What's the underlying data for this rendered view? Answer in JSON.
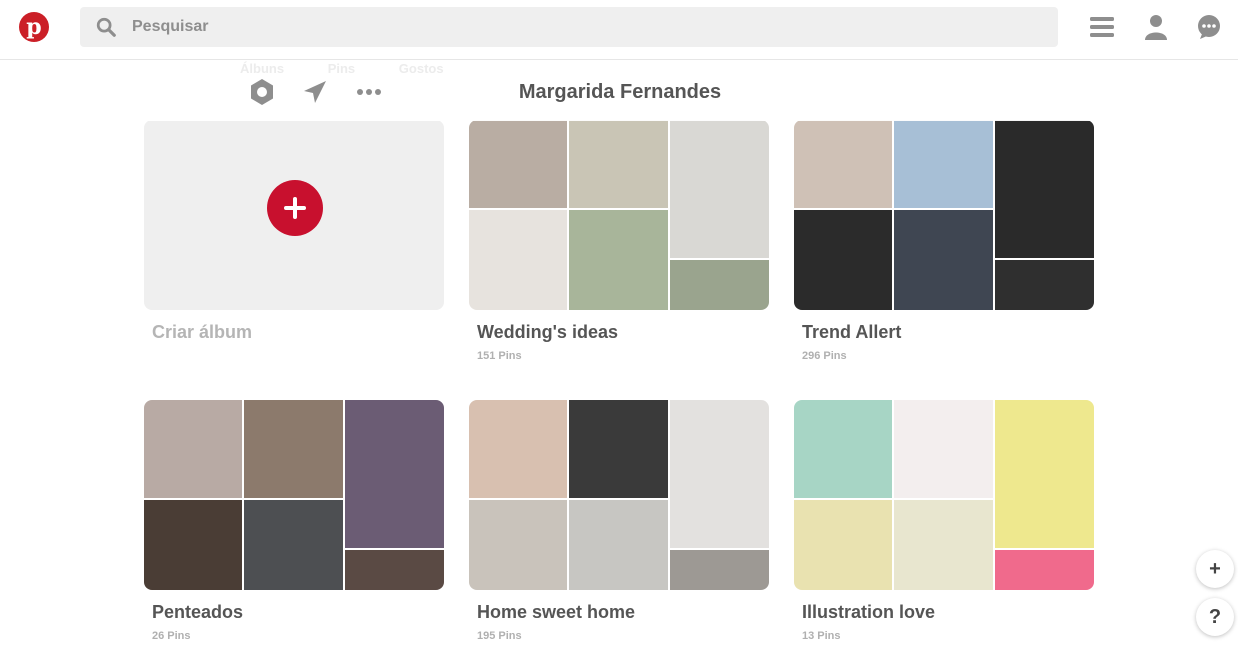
{
  "header": {
    "logo_letter": "p",
    "search_placeholder": "Pesquisar",
    "icons": [
      "menu-icon",
      "profile-icon",
      "messages-icon"
    ]
  },
  "profile": {
    "name": "Margarida Fernandes",
    "faint_tabs": [
      "Álbuns",
      "Pins",
      "Gostos"
    ],
    "actions": [
      "settings-icon",
      "send-icon",
      "more-icon"
    ]
  },
  "create_album": {
    "label": "Criar álbum"
  },
  "boards": [
    {
      "title": "Wedding's ideas",
      "count": "151 Pins",
      "tiles": [
        "#b9ada3",
        "#e7e3de",
        "#c9c5b5",
        "#a8b59a",
        "#d9d8d4",
        "#9aa48e",
        "#7e8e63"
      ]
    },
    {
      "title": "Trend Allert",
      "count": "296 Pins",
      "tiles": [
        "#cfc1b6",
        "#a7bfd6",
        "#2a2a2a",
        "#2b2b2b",
        "#3f4652",
        "#d8d6d2",
        "#2f2f2f"
      ]
    },
    {
      "title": "Penteados",
      "count": "26 Pins",
      "tiles": [
        "#b8aaa4",
        "#8c7a6c",
        "#6b5c74",
        "#4a3d35",
        "#4d4f52",
        "#5a4a44"
      ]
    },
    {
      "title": "Home sweet home",
      "count": "195 Pins",
      "tiles": [
        "#d8c0b0",
        "#3a3a3a",
        "#e3e1df",
        "#c9c3bb",
        "#c7c6c2",
        "#a69a8d",
        "#9d9994"
      ]
    },
    {
      "title": "Illustration love",
      "count": "13 Pins",
      "tiles": [
        "#a7d5c5",
        "#f3eeee",
        "#eee88e",
        "#e9e2b0",
        "#e8e6cf",
        "#f06a8c"
      ]
    }
  ],
  "fab": {
    "add_label": "+",
    "help_label": "?"
  }
}
